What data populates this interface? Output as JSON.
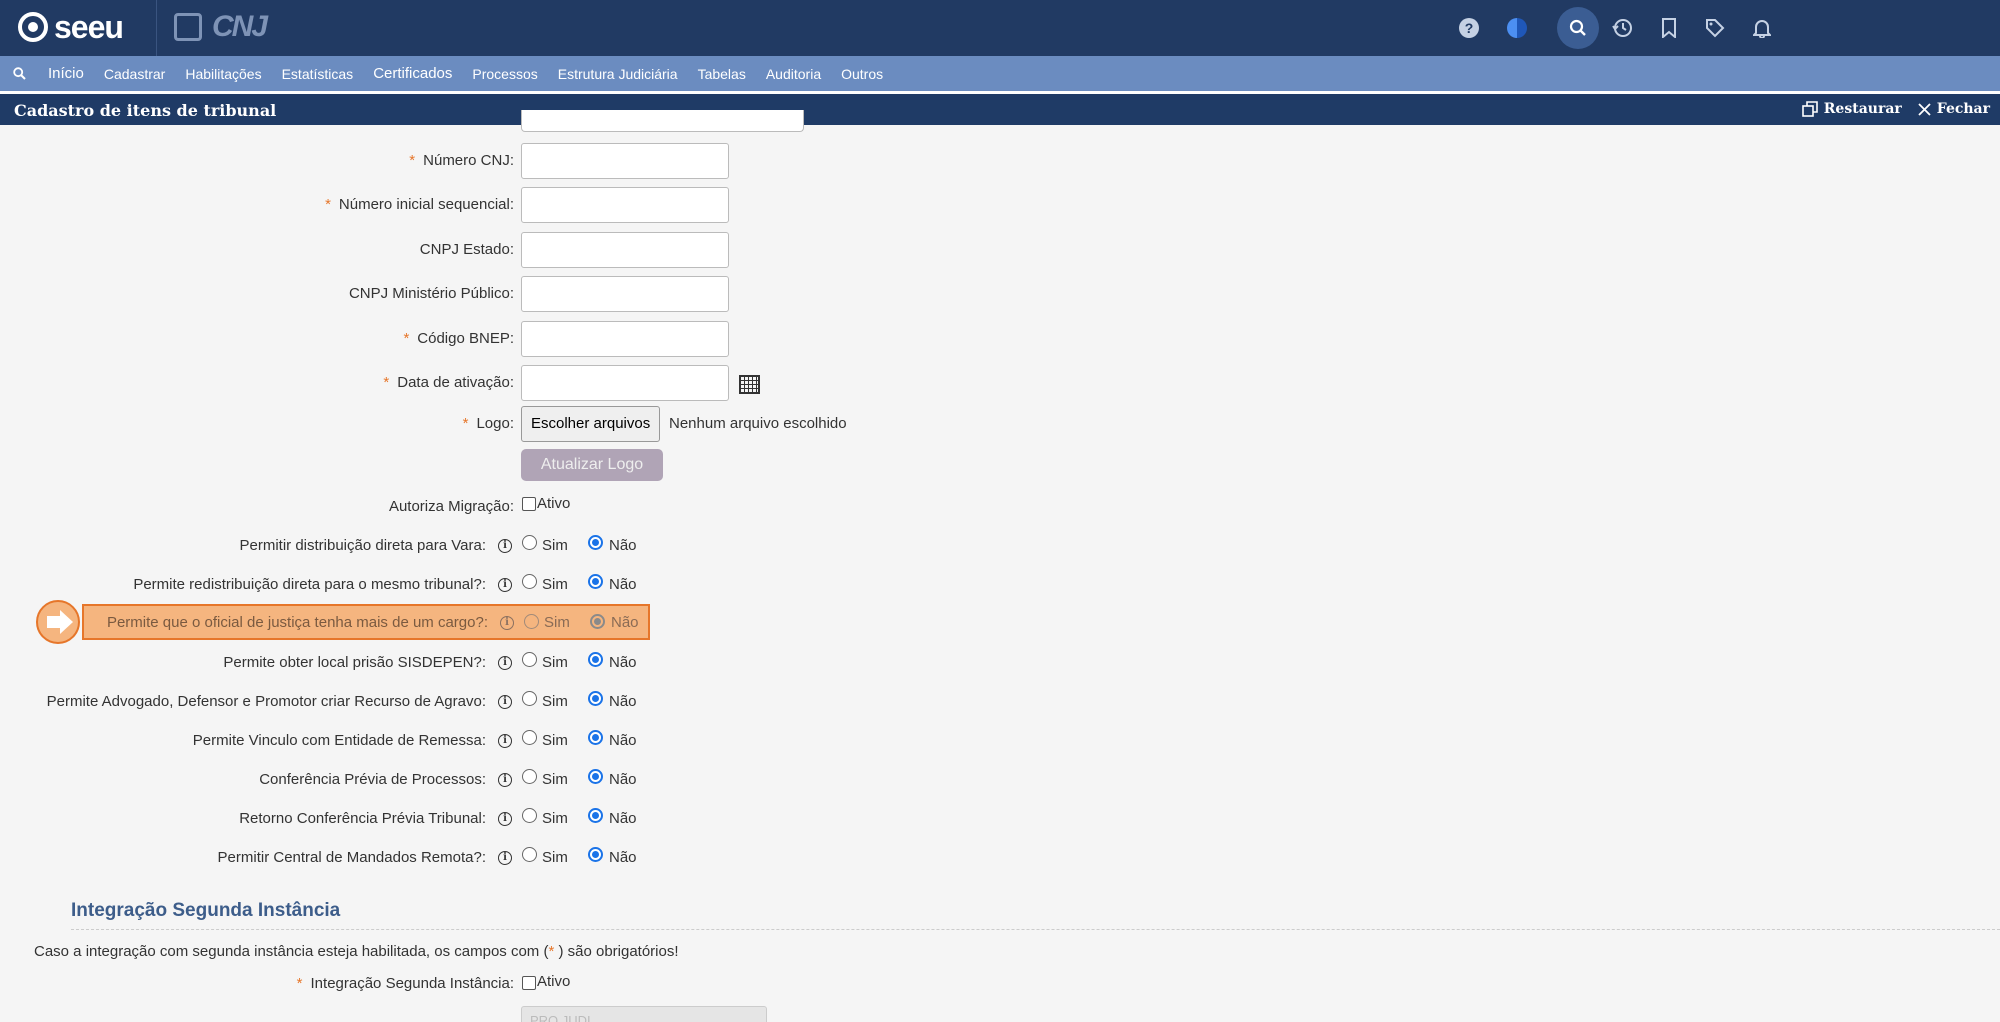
{
  "app": {
    "brand": "seeu",
    "partner": "CNJ"
  },
  "nav": {
    "items": [
      {
        "label": "Início",
        "bold": true
      },
      {
        "label": "Cadastrar"
      },
      {
        "label": "Habilitações"
      },
      {
        "label": "Estatísticas"
      },
      {
        "label": "Certificados",
        "bold": true
      },
      {
        "label": "Processos"
      },
      {
        "label": "Estrutura Judiciária"
      },
      {
        "label": "Tabelas"
      },
      {
        "label": "Auditoria"
      },
      {
        "label": "Outros"
      }
    ]
  },
  "window": {
    "title": "Cadastro de itens de tribunal",
    "restore_label": "Restaurar",
    "close_label": "Fechar"
  },
  "form": {
    "numero_cnj": "Número CNJ:",
    "numero_inicial": "Número inicial sequencial:",
    "cnpj_estado": "CNPJ Estado:",
    "cnpj_mp": "CNPJ Ministério Público:",
    "codigo_bnep": "Código BNEP:",
    "data_ativacao": "Data de ativação:",
    "logo": "Logo:",
    "file_button": "Escolher arquivos",
    "file_none": "Nenhum arquivo escolhido",
    "update_logo": "Atualizar Logo",
    "autoriza_migracao": "Autoriza Migração:",
    "ativo": "Ativo",
    "required_mark": "*"
  },
  "radio_labels": {
    "sim": "Sim",
    "nao": "Não"
  },
  "radios": [
    "Permitir distribuição direta para Vara:",
    "Permite redistribuição direta para o mesmo tribunal?:",
    "Permite que o oficial de justiça tenha mais de um cargo?:",
    "Permite obter local prisão SISDEPEN?:",
    "Permite Advogado, Defensor e Promotor criar Recurso de Agravo:",
    "Permite Vinculo com Entidade de Remessa:",
    "Conferência Prévia de Processos:",
    "Retorno Conferência Prévia Tribunal:",
    "Permitir Central de Mandados Remota?:"
  ],
  "section": {
    "title": "Integração Segunda Instância",
    "note_pre": "Caso a integração com segunda instância esteja habilitada, os campos com (",
    "note_post": " ) são obrigatórios!",
    "field_label": "Integração Segunda Instância:",
    "field_value": "Ativo",
    "cut_input_value": "PRO JUDI"
  }
}
